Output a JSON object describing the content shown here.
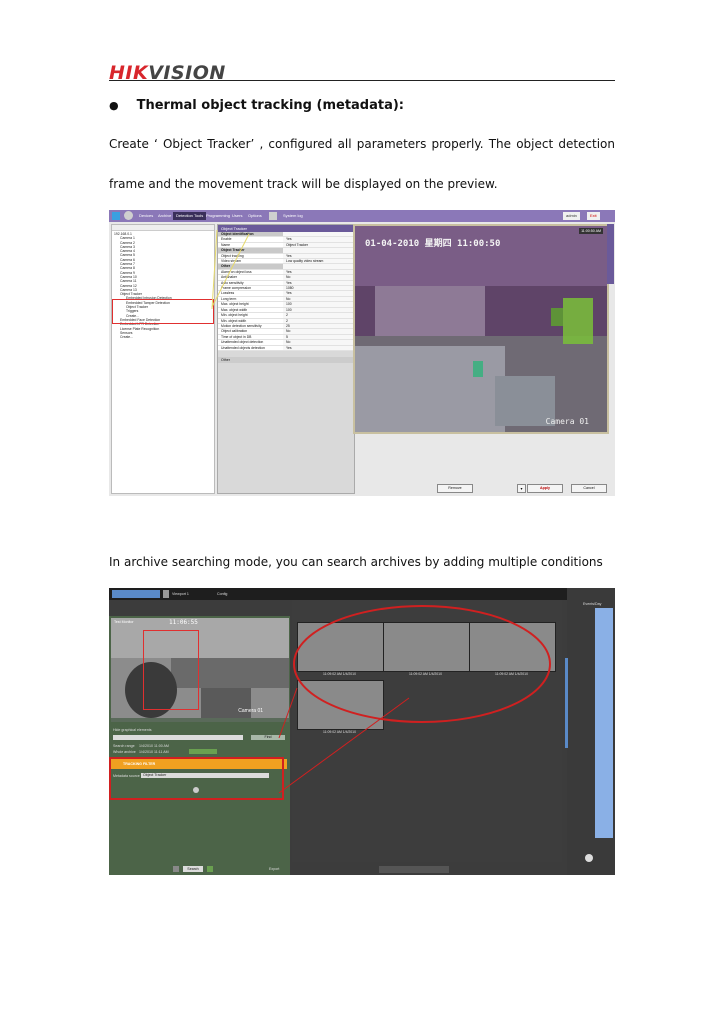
{
  "header": {
    "logo_text_red": "HIK",
    "logo_text_dark": "VISION"
  },
  "section": {
    "heading": "Thermal object tracking (metadata):",
    "para1_line1": "Create ‘ Object Tracker’ , configured all parameters properly. The object detection",
    "para1_line2": "frame and the movement track will be displayed on the preview.",
    "para2": "In archive searching mode, you can search archives by adding multiple conditions"
  },
  "shot1": {
    "tabs": [
      "Devices",
      "Archive",
      "Detection Tools",
      "Programming",
      "Users",
      "Options"
    ],
    "active_tab": "Detection Tools",
    "system_log": "System log",
    "user_label": "admin",
    "exit_label": "Exit",
    "tree_items": [
      "192.168.0.1",
      "Camera 1",
      "Camera 2",
      "Camera 3",
      "Camera 4",
      "Camera 5",
      "Camera 6",
      "Camera 7",
      "Camera 8",
      "Camera 9",
      "Camera 10",
      "Camera 11",
      "Camera 12",
      "Camera 13",
      "Object Tracker",
      "Embedded Intrusion Detection",
      "Embedded Tamper Detection",
      "Object Tracker",
      "Triggers",
      "Create...",
      "Embedded Face Detection",
      "Embedded LPR Detection",
      "License Plate Recognition",
      "Sensors",
      "Create..."
    ],
    "props_title": "Object Tracker",
    "props_rows": [
      {
        "k": "Object identification",
        "v": "",
        "section": true
      },
      {
        "k": "Enable",
        "v": "Yes"
      },
      {
        "k": "Name",
        "v": "Object Tracker"
      },
      {
        "k": "Object Tracker",
        "v": "",
        "section": true
      },
      {
        "k": "Object tracking",
        "v": "Yes"
      },
      {
        "k": "Video stream",
        "v": "Low quality video stream"
      },
      {
        "k": "Other",
        "v": "",
        "section": true
      },
      {
        "k": "Alarm on object loss",
        "v": "Yes"
      },
      {
        "k": "Antishaker",
        "v": "No"
      },
      {
        "k": "Auto sensitivity",
        "v": "Yes"
      },
      {
        "k": "Frame compression",
        "v": "1080"
      },
      {
        "k": "Lossless",
        "v": "Yes"
      },
      {
        "k": "Long term",
        "v": "No"
      },
      {
        "k": "Max. object height",
        "v": "100"
      },
      {
        "k": "Max. object width",
        "v": "100"
      },
      {
        "k": "Min. object height",
        "v": "2"
      },
      {
        "k": "Min. object width",
        "v": "2"
      },
      {
        "k": "Motion detection sensitivity",
        "v": "25"
      },
      {
        "k": "Object calibration",
        "v": "No"
      },
      {
        "k": "Time of object in DB",
        "v": "5"
      },
      {
        "k": "Unattended object detection",
        "v": "No"
      },
      {
        "k": "Unattended objects detection",
        "v": "Yes"
      }
    ],
    "props_footer": "Other",
    "osd_date": "01-04-2010 星期四 11:00:50",
    "osd_camera": "Camera 01",
    "osd_time": "11:00:50 AM",
    "btn_remove": "Remove",
    "btn_apply": "Apply",
    "btn_cancel": "Cancel"
  },
  "shot2": {
    "tab1": "Viewport 1",
    "tab2": "Config",
    "video_label": "Test Monitor",
    "video_time": "11:06:55",
    "video_cam": "Camera 01",
    "thumb_label": "11:09:02 AM 1/4/2010",
    "hide_graphical": "Hide graphical elements",
    "search_range": "Search range",
    "whole_archive": "Whole archive",
    "range_from": "1/4/2010 11:00 AM",
    "range_to": "1/4/2010 11:11 AM",
    "find_label": "Find",
    "condition_title": "TRACKING FILTER",
    "metadata_source_label": "Metadata source",
    "metadata_source_value": "Object Tracker",
    "search_btn": "Search",
    "export_label": "Export",
    "timeline_label": "Events/Day"
  },
  "colors": {
    "logo_red": "#d8262c",
    "annotation_red": "#d02020",
    "shot1_titlebar": "#8b78b8",
    "shot2_leftpanel": "#4c6448",
    "condition_orange": "#f0a020"
  }
}
